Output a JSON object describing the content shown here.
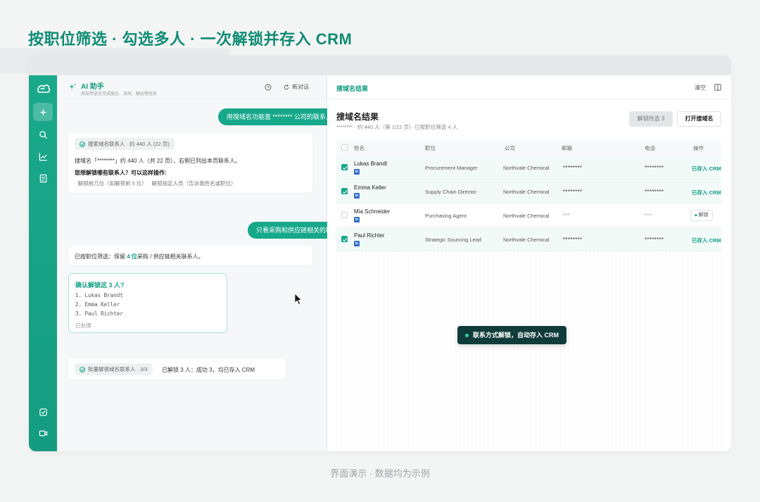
{
  "headline": "按职位筛选 · 勾选多人 · 一次解锁并存入 CRM",
  "assistant": {
    "title": "AI 助手",
    "subtitle": "用自然语言完成搜企、海关、触达等任务",
    "new_chat": "新对话"
  },
  "sidebar": {
    "items": [
      "sparkle-icon",
      "search-icon",
      "chart-icon",
      "document-icon",
      "checkbox-icon",
      "video-icon"
    ]
  },
  "chat": {
    "user_msg_1": "用搜域名功能查 ******** 公司的联系人",
    "tool_chip_1": "搜索域名联系人 · 约 440 人 (22 页)",
    "reply_1_line1": "搜域名「********」约 440 人（共 22 页），右侧已列出本页联系人。",
    "reply_1_line2": "您想解锁哪些联系人？可以这样操作:",
    "reply_1_line3": "· 解锁前几位（如解锁前 5 位） · 解锁指定人员（告诉我姓名或职位）",
    "user_msg_2": "只看采购和供应链相关的职位",
    "reply_2_prefix": "已按职位筛选：保留 ",
    "reply_2_highlight": "4 位",
    "reply_2_suffix": "采购 / 供应链相关联系人。",
    "confirm_title": "确认解锁这 3 人?",
    "confirm_items": [
      "1. Lukas Brandt",
      "2. Emma Keller",
      "3. Paul Richter"
    ],
    "confirm_status": "已处理",
    "tool_chip_2": "批量解锁域名联系人 · 3/3",
    "reply_3": "已解锁 3 人：成功 3，均已存入 CRM"
  },
  "results": {
    "tab": "搜域名结果",
    "clear": "清空",
    "title": "搜域名结果",
    "subtitle": "******** · 约 440 人（第 1/22 页）· 已按职位筛选 4 人",
    "btn_unlock_selected": "解锁所选 3",
    "btn_open": "打开搜域名",
    "columns": [
      "姓名",
      "职位",
      "公司",
      "邮箱",
      "电话",
      "操作"
    ],
    "rows": [
      {
        "name": "Lukas Brandt",
        "title": "Procurement Manager",
        "company": "Northvale Chemical",
        "email": "********",
        "phone": "********",
        "action": "已存入 CRM",
        "checked": true
      },
      {
        "name": "Emma Keller",
        "title": "Supply Chain Director",
        "company": "Northvale Chemical",
        "email": "********",
        "phone": "********",
        "action": "已存入 CRM",
        "checked": true
      },
      {
        "name": "Mia Schneider",
        "title": "Purchasing Agent",
        "company": "Northvale Chemical",
        "email": "***",
        "phone": "***",
        "action": "解锁",
        "checked": false
      },
      {
        "name": "Paul Richter",
        "title": "Strategic Sourcing Lead",
        "company": "Northvale Chemical",
        "email": "********",
        "phone": "********",
        "action": "已存入 CRM",
        "checked": true
      }
    ],
    "linkedin_badge": "in"
  },
  "toast": "联系方式解锁，自动存入 CRM",
  "footer_note": "界面演示 · 数据均为示例",
  "colors": {
    "accent": "#17a88a",
    "headline": "#0f8c73",
    "toast_bg": "#0f3b38"
  }
}
